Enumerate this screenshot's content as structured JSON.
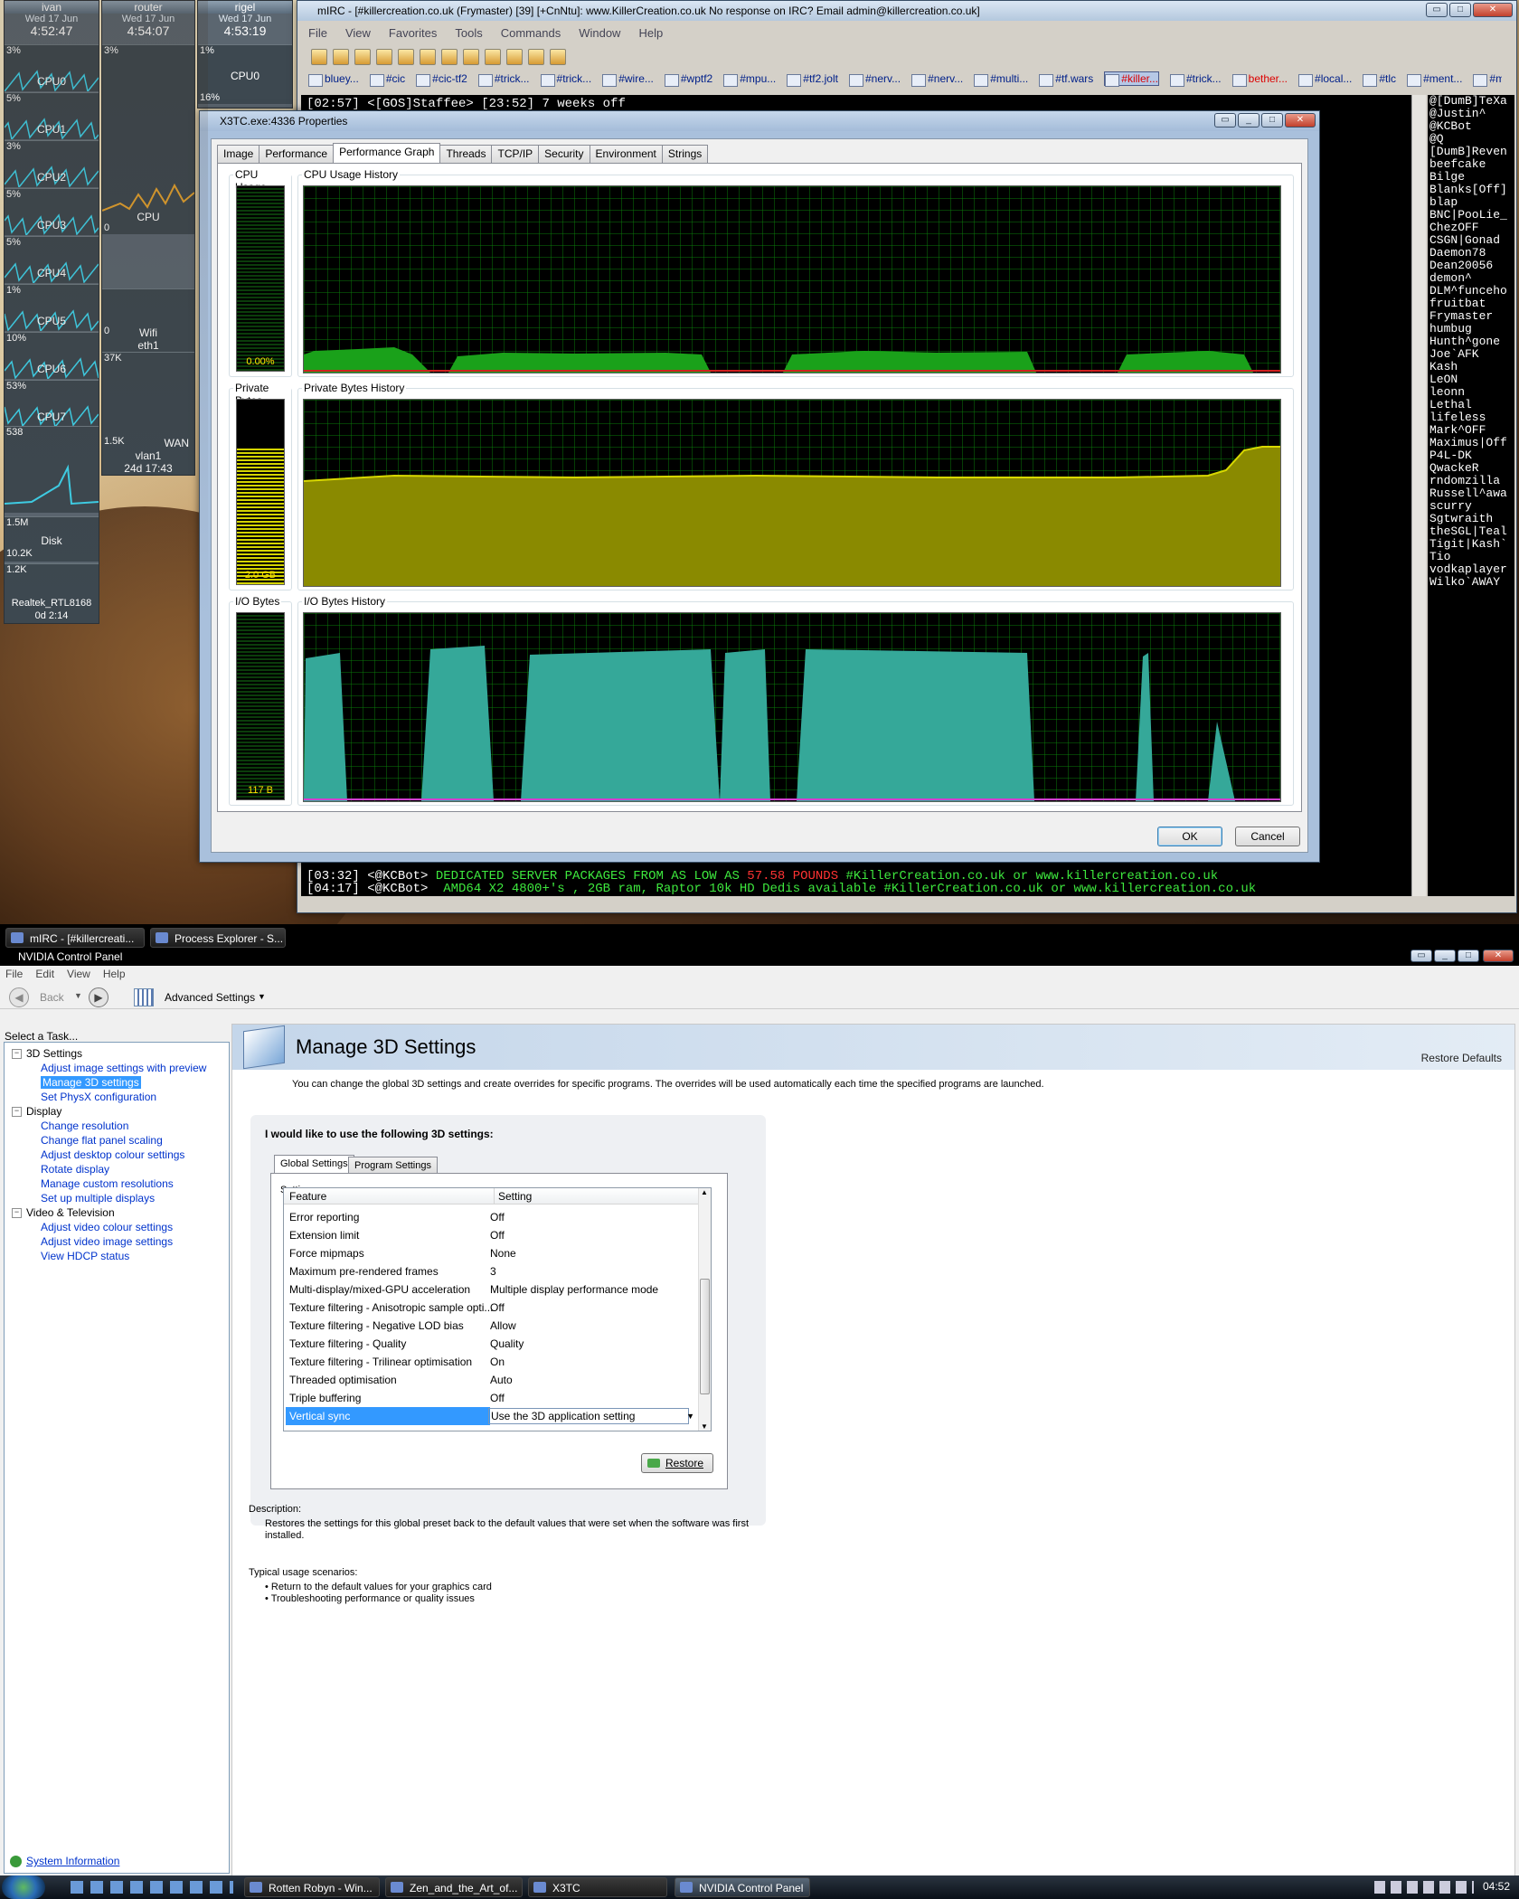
{
  "meters": {
    "ivan": {
      "name": "ivan",
      "date": "Wed 17 Jun",
      "time": "4:52:47"
    },
    "router": {
      "name": "router",
      "date": "Wed 17 Jun",
      "time": "4:54:07"
    },
    "rigel": {
      "name": "rigel",
      "date": "Wed 17 Jun",
      "time": "4:53:19"
    },
    "ivan_cpus": [
      {
        "pct": "3%",
        "label": "CPU0"
      },
      {
        "pct": "5%",
        "label": "CPU1"
      },
      {
        "pct": "3%",
        "label": "CPU2"
      },
      {
        "pct": "5%",
        "label": "CPU3"
      },
      {
        "pct": "5%",
        "label": "CPU4"
      },
      {
        "pct": "1%",
        "label": "CPU5"
      },
      {
        "pct": "10%",
        "label": "CPU6"
      },
      {
        "pct": "53%",
        "label": "CPU7"
      }
    ],
    "ivan_mem": "538",
    "ivan_disk": {
      "top": "1.5M",
      "label": "Disk",
      "val": "10.2K"
    },
    "ivan_net": {
      "val": "1.2K",
      "label": "Realtek_RTL8168",
      "uptime": "0d 2:14"
    },
    "router_cpu": {
      "pct": "3%",
      "label": "CPU",
      "val": "0"
    },
    "router_wifi": {
      "val": "0",
      "label": "Wifi",
      "iface": "eth1"
    },
    "router_wan": {
      "top": "37K",
      "val": "1.5K",
      "label": "WAN",
      "iface": "vlan1",
      "uptime": "24d 17:43"
    },
    "rigel_cpu": {
      "pct": "1%",
      "label": "CPU0",
      "pct2": "16%"
    }
  },
  "mirc": {
    "title": "mIRC - [#killercreation.co.uk (Frymaster) [39] [+CnNtu]: www.KillerCreation.co.uk  No response on IRC? Email admin@killercreation.co.uk]",
    "menu": [
      "File",
      "View",
      "Favorites",
      "Tools",
      "Commands",
      "Window",
      "Help"
    ],
    "switchbar": [
      {
        "label": "bluey...",
        "state": ""
      },
      {
        "label": "#cic",
        "state": ""
      },
      {
        "label": "#cic-tf2",
        "state": ""
      },
      {
        "label": "#trick...",
        "state": ""
      },
      {
        "label": "#trick...",
        "state": ""
      },
      {
        "label": "#wire...",
        "state": ""
      },
      {
        "label": "#wptf2",
        "state": ""
      },
      {
        "label": "#mpu...",
        "state": ""
      },
      {
        "label": "#tf2.jolt",
        "state": ""
      },
      {
        "label": "#nerv...",
        "state": ""
      },
      {
        "label": "#nerv...",
        "state": ""
      },
      {
        "label": "#multi...",
        "state": ""
      },
      {
        "label": "#tf.wars",
        "state": ""
      },
      {
        "label": "#killer...",
        "state": "act red"
      },
      {
        "label": "#trick...",
        "state": ""
      },
      {
        "label": "bether...",
        "state": "red"
      },
      {
        "label": "#local...",
        "state": ""
      },
      {
        "label": "#tlc",
        "state": ""
      },
      {
        "label": "#ment...",
        "state": ""
      },
      {
        "label": "#mid&d",
        "state": ""
      }
    ],
    "line1": "[02:57] <[GOS]Staffee> [23:52] 7 weeks off",
    "line2_pre": "[03:32] <@KCBot> ",
    "line2_a": "DEDICATED SERVER PACKAGES FROM AS LOW AS ",
    "line2_price": "57.58 POUNDS",
    "line2_b": " #KillerCreation.co.uk or www.killercreation.co.uk",
    "line3_pre": "[04:17] <@KCBot> ",
    "line3": " AMD64 X2 4800+'s , 2GB ram, Raptor 10k HD Dedis available #KillerCreation.co.uk or www.killercreation.co.uk",
    "nicks": [
      "@[DumB]TeXa",
      "@Justin^",
      "@KCBot",
      "@Q",
      "[DumB]Reven",
      "beefcake",
      "Bilge",
      "Blanks[Off]",
      "blap",
      "BNC|PooLie_",
      "ChezOFF",
      "CSGN|Gonad",
      "Daemon78",
      "Dean20056",
      "demon^",
      "DLM^funceho",
      "fruitbat",
      "Frymaster",
      "humbug",
      "Hunth^gone",
      "Joe`AFK",
      "Kash",
      "LeON",
      "leonn",
      "Lethal",
      "lifeless",
      "Mark^OFF",
      "Maximus|Off",
      "P4L-DK",
      "QwackeR",
      "rndomzilla",
      "Russell^awa",
      "scurry",
      "Sgtwraith",
      "theSGL|Teal",
      "Tigit|Kash`",
      "Tio",
      "vodkaplayer",
      "Wilko`AWAY"
    ]
  },
  "props": {
    "title": "X3TC.exe:4336 Properties",
    "tabs": [
      "Image",
      "Performance",
      "Performance Graph",
      "Threads",
      "TCP/IP",
      "Security",
      "Environment",
      "Strings"
    ],
    "cpu_label": "CPU Usage",
    "cpu_hist_label": "CPU Usage History",
    "cpu_value": "0.00%",
    "pb_label": "Private Bytes",
    "pb_hist_label": "Private Bytes History",
    "pb_value": "2.0 GB",
    "io_label": "I/O Bytes",
    "io_hist_label": "I/O Bytes History",
    "io_value": "117 B",
    "ok": "OK",
    "cancel": "Cancel"
  },
  "taskbar_top": [
    "mIRC - [#killercreati...",
    "Process Explorer - S..."
  ],
  "nvidia": {
    "title": "NVIDIA Control Panel",
    "menu": [
      "File",
      "Edit",
      "View",
      "Help"
    ],
    "back": "Back",
    "advanced": "Advanced Settings",
    "select_task": "Select a Task...",
    "tree": [
      {
        "type": "h",
        "label": "3D Settings"
      },
      {
        "type": "i",
        "label": "Adjust image settings with preview"
      },
      {
        "type": "i sel",
        "label": "Manage 3D settings"
      },
      {
        "type": "i",
        "label": "Set PhysX configuration"
      },
      {
        "type": "h",
        "label": "Display"
      },
      {
        "type": "i",
        "label": "Change resolution"
      },
      {
        "type": "i",
        "label": "Change flat panel scaling"
      },
      {
        "type": "i",
        "label": "Adjust desktop colour settings"
      },
      {
        "type": "i",
        "label": "Rotate display"
      },
      {
        "type": "i",
        "label": "Manage custom resolutions"
      },
      {
        "type": "i",
        "label": "Set up multiple displays"
      },
      {
        "type": "h",
        "label": "Video & Television"
      },
      {
        "type": "i",
        "label": "Adjust video colour settings"
      },
      {
        "type": "i",
        "label": "Adjust video image settings"
      },
      {
        "type": "i",
        "label": "View HDCP status"
      }
    ],
    "system_info": "System Information",
    "page_title": "Manage 3D Settings",
    "restore_defaults": "Restore Defaults",
    "intro": "You can change the global 3D settings and create overrides for specific programs. The overrides will be used automatically each time the specified programs are launched.",
    "like_to_use": "I would like to use the following 3D settings:",
    "tab_global": "Global Settings",
    "tab_program": "Program Settings",
    "settings_label": "Settings:",
    "col_feature": "Feature",
    "col_setting": "Setting",
    "rows": [
      {
        "f": "Error reporting",
        "s": "Off"
      },
      {
        "f": "Extension limit",
        "s": "Off"
      },
      {
        "f": "Force mipmaps",
        "s": "None"
      },
      {
        "f": "Maximum pre-rendered frames",
        "s": "3"
      },
      {
        "f": "Multi-display/mixed-GPU acceleration",
        "s": "Multiple display performance mode"
      },
      {
        "f": "Texture filtering - Anisotropic sample opti...",
        "s": "Off"
      },
      {
        "f": "Texture filtering - Negative LOD bias",
        "s": "Allow"
      },
      {
        "f": "Texture filtering - Quality",
        "s": "Quality"
      },
      {
        "f": "Texture filtering - Trilinear optimisation",
        "s": "On"
      },
      {
        "f": "Threaded optimisation",
        "s": "Auto"
      },
      {
        "f": "Triple buffering",
        "s": "Off"
      },
      {
        "f": "Vertical sync",
        "s": "Use the 3D application setting"
      }
    ],
    "restore": "Restore",
    "desc_label": "Description:",
    "desc": "Restores the settings for this global preset back to the default values that were set when the software was first installed.",
    "usage_label": "Typical usage scenarios:",
    "usage": [
      "Return to the default values for your graphics card",
      "Troubleshooting performance or quality issues"
    ]
  },
  "taskbar_bottom": {
    "items": [
      "Rotten Robyn - Win...",
      "Zen_and_the_Art_of...",
      "X3TC",
      "NVIDIA Control Panel"
    ],
    "clock": "04:52"
  }
}
